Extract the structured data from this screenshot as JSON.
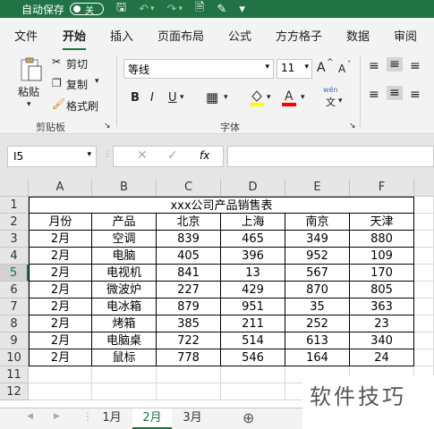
{
  "titlebar": {
    "autosave_label": "自动保存",
    "toggle_label": "关"
  },
  "ribbon_tabs": [
    "文件",
    "开始",
    "插入",
    "页面布局",
    "公式",
    "方方格子",
    "数据",
    "审阅"
  ],
  "active_tab": "开始",
  "clipboard": {
    "paste": "粘贴",
    "cut": "剪切",
    "copy": "复制",
    "format_painter": "格式刷",
    "group_label": "剪贴板"
  },
  "font": {
    "name": "等线",
    "size": "11",
    "group_label": "字体",
    "grow": "A",
    "shrink": "A",
    "bold": "B",
    "italic": "I",
    "underline": "U",
    "wen": "wén",
    "wen_char": "文",
    "fill_color": "#ffff00",
    "font_color": "#ff0000"
  },
  "formula_bar": {
    "name_box": "I5",
    "fx": "fx",
    "value": ""
  },
  "columns": [
    "A",
    "B",
    "C",
    "D",
    "E",
    "F"
  ],
  "rows": [
    "1",
    "2",
    "3",
    "4",
    "5",
    "6",
    "7",
    "8",
    "9",
    "10",
    "11",
    "12"
  ],
  "selected_row": "5",
  "sheet_title": "xxx公司产品销售表",
  "headers": [
    "月份",
    "产品",
    "北京",
    "上海",
    "南京",
    "天津"
  ],
  "table": [
    [
      "2月",
      "空调",
      "839",
      "465",
      "349",
      "880"
    ],
    [
      "2月",
      "电脑",
      "405",
      "396",
      "952",
      "109"
    ],
    [
      "2月",
      "电视机",
      "841",
      "13",
      "567",
      "170"
    ],
    [
      "2月",
      "微波炉",
      "227",
      "429",
      "870",
      "805"
    ],
    [
      "2月",
      "电冰箱",
      "879",
      "951",
      "35",
      "363"
    ],
    [
      "2月",
      "烤箱",
      "385",
      "211",
      "252",
      "23"
    ],
    [
      "2月",
      "电脑桌",
      "722",
      "514",
      "613",
      "340"
    ],
    [
      "2月",
      "鼠标",
      "778",
      "546",
      "164",
      "24"
    ]
  ],
  "sheet_tabs": [
    "1月",
    "2月",
    "3月"
  ],
  "active_sheet": "2月",
  "watermark": "软件技巧"
}
